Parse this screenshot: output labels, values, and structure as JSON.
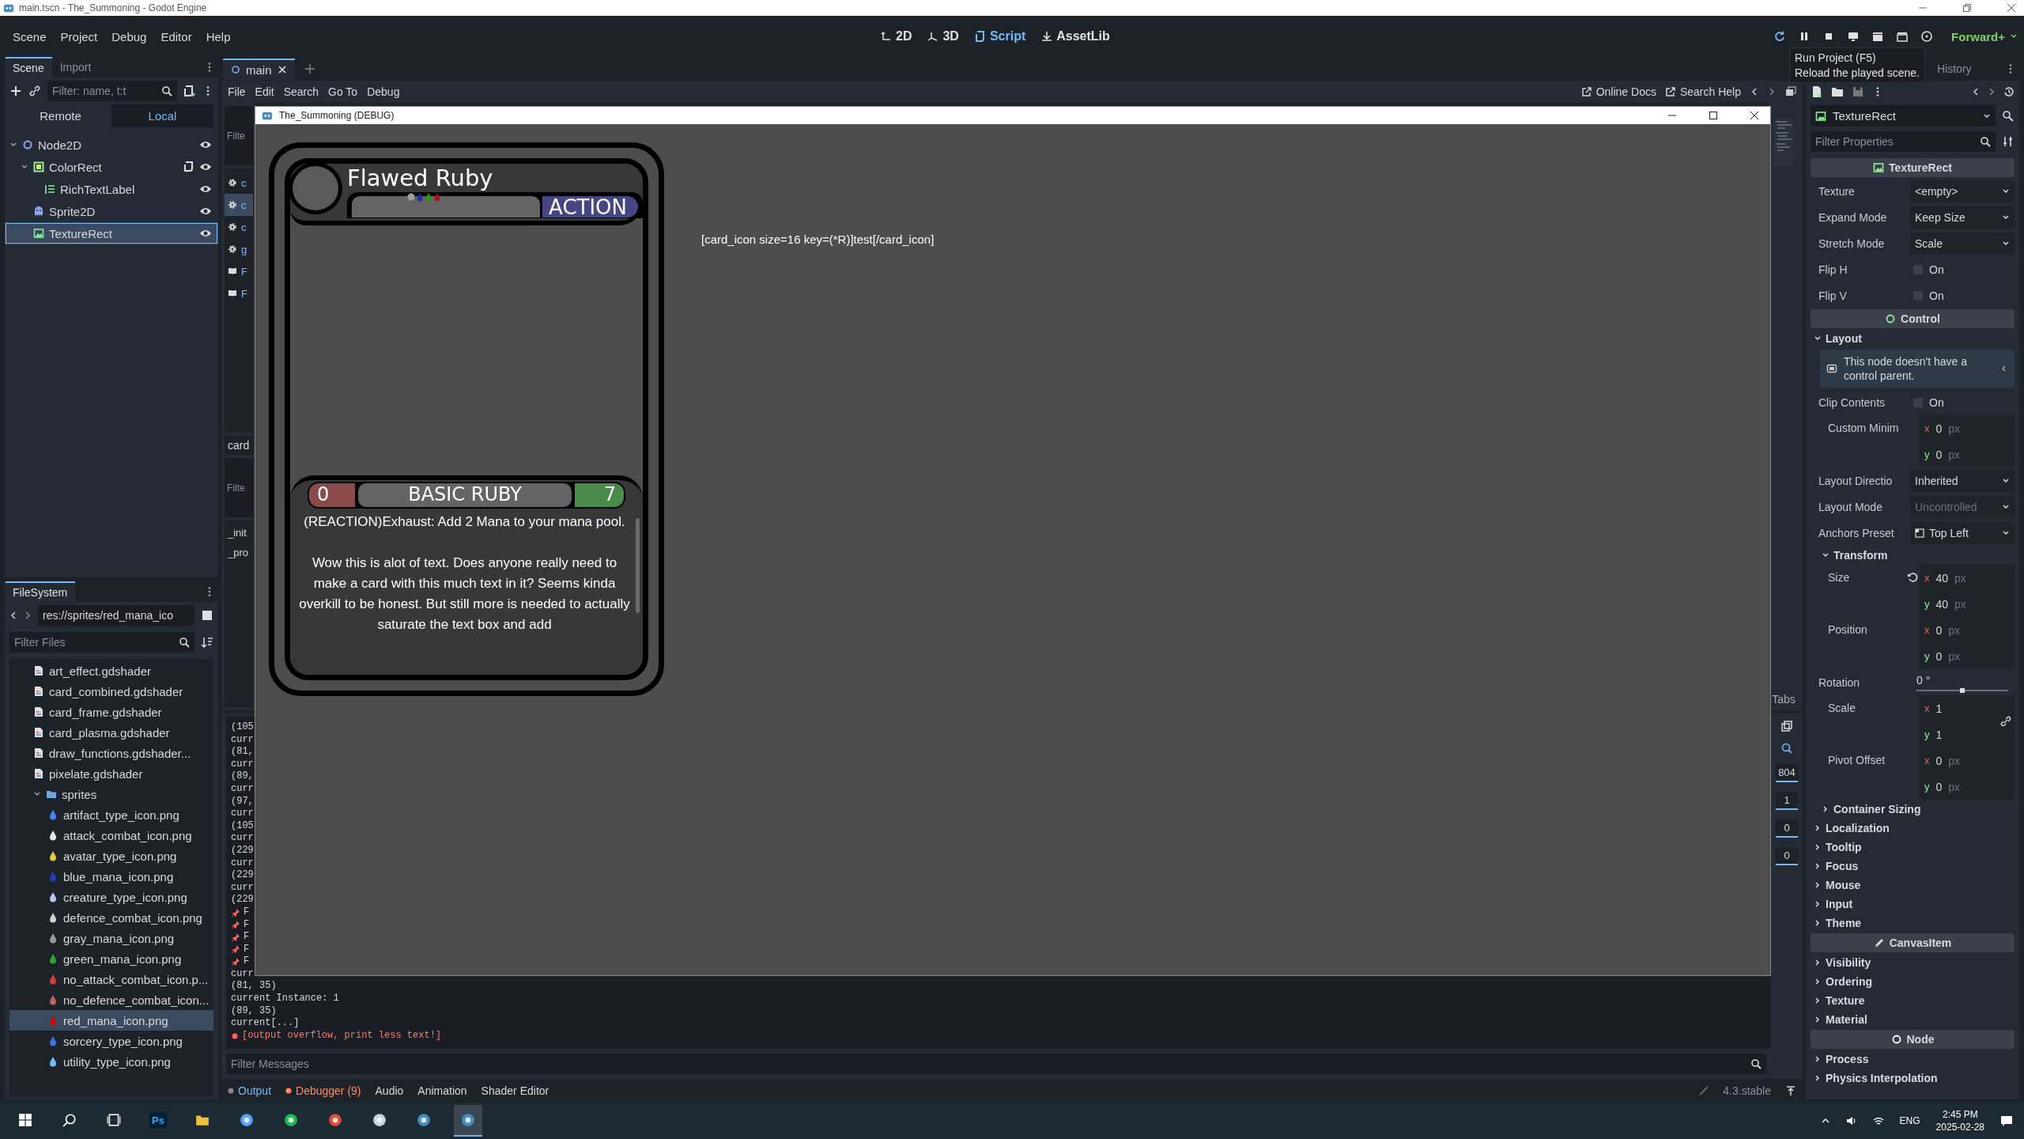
{
  "window": {
    "title": "main.tscn - The_Summoning - Godot Engine"
  },
  "main_menu": [
    "Scene",
    "Project",
    "Debug",
    "Editor",
    "Help"
  ],
  "workspaces": [
    {
      "label": "2D",
      "kind": "canvas",
      "selected": false
    },
    {
      "label": "3D",
      "kind": "spatial",
      "selected": false
    },
    {
      "label": "Script",
      "kind": "script",
      "selected": true
    },
    {
      "label": "AssetLib",
      "kind": "assetlib",
      "selected": false
    }
  ],
  "renderer": "Forward+",
  "tooltip": [
    "Run Project (F5)",
    "Reload the played scene."
  ],
  "scene_dock": {
    "tabs": [
      {
        "label": "Scene",
        "selected": true
      },
      {
        "label": "Import",
        "selected": false
      }
    ],
    "filter_placeholder": "Filter: name, t:t",
    "modes": [
      {
        "label": "Remote",
        "selected": false
      },
      {
        "label": "Local",
        "selected": true
      }
    ],
    "tree": [
      {
        "label": "Node2D",
        "kind": "node2d",
        "selected": false,
        "children": [
          {
            "label": "ColorRect",
            "kind": "colorrect",
            "script": true,
            "selected": false,
            "children": [
              {
                "label": "RichTextLabel",
                "kind": "richtext",
                "selected": false
              }
            ]
          },
          {
            "label": "Sprite2D",
            "kind": "sprite",
            "selected": false
          },
          {
            "label": "TextureRect",
            "kind": "texturerect",
            "selected": true
          }
        ]
      }
    ]
  },
  "filesystem": {
    "title": "FileSystem",
    "path": "res://sprites/red_mana_ico",
    "filter_placeholder": "Filter Files",
    "items": [
      {
        "label": "art_effect.gdshader",
        "kind": "shader",
        "selected": false
      },
      {
        "label": "card_combined.gdshader",
        "kind": "shader",
        "selected": false
      },
      {
        "label": "card_frame.gdshader",
        "kind": "shader",
        "selected": false
      },
      {
        "label": "card_plasma.gdshader",
        "kind": "shader",
        "selected": false
      },
      {
        "label": "draw_functions.gdshader...",
        "kind": "shader",
        "selected": false
      },
      {
        "label": "pixelate.gdshader",
        "kind": "shader",
        "selected": false
      },
      {
        "label": "sprites",
        "kind": "folder",
        "selected": false,
        "children": [
          {
            "label": "artifact_type_icon.png",
            "kind": "png",
            "color": "#4a7dff",
            "selected": false
          },
          {
            "label": "attack_combat_icon.png",
            "kind": "png",
            "color": "#e8e8e8",
            "selected": false
          },
          {
            "label": "avatar_type_icon.png",
            "kind": "png",
            "color": "#e8c840",
            "selected": false
          },
          {
            "label": "blue_mana_icon.png",
            "kind": "png",
            "color": "#2040c0",
            "selected": false
          },
          {
            "label": "creature_type_icon.png",
            "kind": "png",
            "color": "#b8c4e8",
            "selected": false
          },
          {
            "label": "defence_combat_icon.png",
            "kind": "png",
            "color": "#d0d0d0",
            "selected": false
          },
          {
            "label": "gray_mana_icon.png",
            "kind": "png",
            "color": "#9a9a9a",
            "selected": false
          },
          {
            "label": "green_mana_icon.png",
            "kind": "png",
            "color": "#30a030",
            "selected": false
          },
          {
            "label": "no_attack_combat_icon.p...",
            "kind": "png",
            "color": "#d04040",
            "selected": false
          },
          {
            "label": "no_defence_combat_icon...",
            "kind": "png",
            "color": "#c06060",
            "selected": false
          },
          {
            "label": "red_mana_icon.png",
            "kind": "png",
            "color": "#c01010",
            "selected": true
          },
          {
            "label": "sorcery_type_icon.png",
            "kind": "png",
            "color": "#4070e0",
            "selected": false
          },
          {
            "label": "utility_type_icon.png",
            "kind": "png",
            "color": "#70c0f0",
            "selected": false
          }
        ]
      }
    ]
  },
  "script_editor": {
    "tabs": [
      {
        "label": "main",
        "selected": true
      }
    ],
    "menu": [
      "File",
      "Edit",
      "Search",
      "Go To",
      "Debug"
    ],
    "links": [
      "Online Docs",
      "Search Help"
    ],
    "list_filter_placeholder": "Filte",
    "scripts": [
      {
        "label": "c",
        "kind": "script",
        "selected": false
      },
      {
        "label": "c",
        "kind": "script",
        "selected": true
      },
      {
        "label": "c",
        "kind": "script",
        "selected": false
      },
      {
        "label": "g",
        "kind": "script",
        "selected": false
      },
      {
        "label": "F",
        "kind": "doc",
        "selected": false
      },
      {
        "label": "F",
        "kind": "doc",
        "selected": false
      }
    ],
    "current": "card",
    "methods_filter_placeholder": "Filte",
    "methods": [
      "_init",
      "_pro"
    ],
    "status": "Tabs"
  },
  "game_window": {
    "title": "The_Summoning (DEBUG)",
    "card": {
      "name": "Flawed Ruby",
      "type": "ACTION",
      "cost": "0",
      "subtitle": "BASIC RUBY",
      "value": "7",
      "mana": [
        {
          "kind": "hex",
          "color": "#a0a0a0"
        },
        {
          "kind": "drop",
          "color": "#1530a8"
        },
        {
          "kind": "drop",
          "color": "#2a9a1a"
        },
        {
          "kind": "drop",
          "color": "#b01010"
        }
      ],
      "text": [
        "(REACTION)Exhaust: Add 2 Mana to your mana pool.",
        "Wow this is alot of text. Does anyone really need to make a card with this much text in it? Seems kinda overkill to be honest. But still more is needed to actually saturate the text box and add"
      ]
    },
    "debug_label": "[card_icon size=16 key=(*R)]test[/card_icon]"
  },
  "output": {
    "lines": [
      {
        "kind": "plain",
        "text": "(105"
      },
      {
        "kind": "plain",
        "text": "curr"
      },
      {
        "kind": "plain",
        "text": "(81,"
      },
      {
        "kind": "plain",
        "text": "curr"
      },
      {
        "kind": "plain",
        "text": "(89,"
      },
      {
        "kind": "plain",
        "text": "curr"
      },
      {
        "kind": "plain",
        "text": "(97,"
      },
      {
        "kind": "plain",
        "text": "curr"
      },
      {
        "kind": "plain",
        "text": "(105"
      },
      {
        "kind": "plain",
        "text": "curr"
      },
      {
        "kind": "plain",
        "text": "(229"
      },
      {
        "kind": "plain",
        "text": "curr"
      },
      {
        "kind": "plain",
        "text": "(229"
      },
      {
        "kind": "plain",
        "text": "curr"
      },
      {
        "kind": "plain",
        "text": "(229"
      },
      {
        "kind": "pin",
        "text": "F"
      },
      {
        "kind": "pin",
        "text": "F"
      },
      {
        "kind": "pin",
        "text": "F"
      },
      {
        "kind": "pin",
        "text": "F"
      },
      {
        "kind": "pin",
        "text": "F"
      },
      {
        "kind": "plain",
        "text": "curr"
      },
      {
        "kind": "plain",
        "text": "(81, 35)"
      },
      {
        "kind": "plain",
        "text": "current Instance: 1"
      },
      {
        "kind": "plain",
        "text": "(89, 35)"
      },
      {
        "kind": "plain",
        "text": "current[...]"
      },
      {
        "kind": "error",
        "text": "[output overflow, print less text!]"
      }
    ],
    "filter_placeholder": "Filter Messages",
    "counters": [
      "804",
      "1",
      "0",
      "0"
    ],
    "tabs": [
      {
        "label": "Output",
        "selected": true,
        "color": "#8c7f8f"
      },
      {
        "label": "Debugger (9)",
        "selected": false,
        "color": "#ff8a5c"
      },
      {
        "label": "Audio",
        "selected": false
      },
      {
        "label": "Animation",
        "selected": false
      },
      {
        "label": "Shader Editor",
        "selected": false
      }
    ],
    "version": "4.3.stable"
  },
  "inspector": {
    "history": "History",
    "object": "TextureRect",
    "filter_placeholder": "Filter Properties",
    "rows": [
      {
        "kind": "class",
        "label": "TextureRect",
        "color": "#8eef97"
      },
      {
        "kind": "dropdown",
        "label": "Texture",
        "value": "<empty>"
      },
      {
        "kind": "dropdown",
        "label": "Expand Mode",
        "value": "Keep Size"
      },
      {
        "kind": "dropdown",
        "label": "Stretch Mode",
        "value": "Scale"
      },
      {
        "kind": "check",
        "label": "Flip H",
        "value": "On",
        "checked": false
      },
      {
        "kind": "check",
        "label": "Flip V",
        "value": "On",
        "checked": false
      },
      {
        "kind": "class",
        "label": "Control",
        "color": "#8eef97"
      },
      {
        "kind": "section",
        "label": "Layout",
        "expanded": true
      },
      {
        "kind": "note",
        "label": "This node doesn't have a control parent."
      },
      {
        "kind": "check",
        "label": "Clip Contents",
        "value": "On",
        "checked": false
      },
      {
        "kind": "xy",
        "label": "Custom Minim",
        "fields": [
          {
            "axis": "x",
            "value": "0",
            "unit": "px"
          },
          {
            "axis": "y",
            "value": "0",
            "unit": "px"
          }
        ]
      },
      {
        "kind": "dropdown",
        "label": "Layout Directio",
        "value": "Inherited"
      },
      {
        "kind": "dropdown",
        "label": "Layout Mode",
        "value": "Uncontrolled",
        "disabled": true
      },
      {
        "kind": "dropdown",
        "label": "Anchors Preset",
        "value": "Top Left",
        "swatch": true
      },
      {
        "kind": "subsection",
        "label": "Transform",
        "expanded": true
      },
      {
        "kind": "xy",
        "label": "Size",
        "reset": true,
        "fields": [
          {
            "axis": "x",
            "value": "40",
            "unit": "px"
          },
          {
            "axis": "y",
            "value": "40",
            "unit": "px"
          }
        ]
      },
      {
        "kind": "xy",
        "label": "Position",
        "fields": [
          {
            "axis": "x",
            "value": "0",
            "unit": "px"
          },
          {
            "axis": "y",
            "value": "0",
            "unit": "px"
          }
        ]
      },
      {
        "kind": "slider",
        "label": "Rotation",
        "value": "0 °",
        "level": 0.5
      },
      {
        "kind": "xy",
        "label": "Scale",
        "linked": true,
        "fields": [
          {
            "axis": "x",
            "value": "1"
          },
          {
            "axis": "y",
            "value": "1"
          }
        ]
      },
      {
        "kind": "xy",
        "label": "Pivot Offset",
        "fields": [
          {
            "axis": "x",
            "value": "0",
            "unit": "px"
          },
          {
            "axis": "y",
            "value": "0",
            "unit": "px"
          }
        ]
      },
      {
        "kind": "subsection",
        "label": "Container Sizing",
        "expanded": false
      },
      {
        "kind": "section",
        "label": "Localization",
        "expanded": false
      },
      {
        "kind": "section",
        "label": "Tooltip",
        "expanded": false
      },
      {
        "kind": "section",
        "label": "Focus",
        "expanded": false
      },
      {
        "kind": "section",
        "label": "Mouse",
        "expanded": false
      },
      {
        "kind": "section",
        "label": "Input",
        "expanded": false
      },
      {
        "kind": "section",
        "label": "Theme",
        "expanded": false
      },
      {
        "kind": "class",
        "label": "CanvasItem",
        "color": "#dcdcdc"
      },
      {
        "kind": "section",
        "label": "Visibility",
        "expanded": false
      },
      {
        "kind": "section",
        "label": "Ordering",
        "expanded": false
      },
      {
        "kind": "section",
        "label": "Texture",
        "expanded": false
      },
      {
        "kind": "section",
        "label": "Material",
        "expanded": false
      },
      {
        "kind": "class",
        "label": "Node",
        "color": "#ffffff"
      },
      {
        "kind": "section",
        "label": "Process",
        "expanded": false
      },
      {
        "kind": "section",
        "label": "Physics Interpolation",
        "expanded": false
      }
    ]
  },
  "taskbar": {
    "apps": [
      {
        "kind": "start",
        "selected": false
      },
      {
        "kind": "search",
        "selected": false
      },
      {
        "kind": "taskview",
        "selected": false
      },
      {
        "kind": "ps",
        "label": "Ps",
        "selected": false
      },
      {
        "kind": "folder",
        "selected": false
      },
      {
        "kind": "radar",
        "selected": false
      },
      {
        "kind": "spotify",
        "selected": false
      },
      {
        "kind": "chrome",
        "selected": false
      },
      {
        "kind": "steam",
        "selected": false
      },
      {
        "kind": "godot",
        "selected": false
      },
      {
        "kind": "godot",
        "selected": true
      }
    ],
    "lang": "ENG",
    "time": "2:45 PM",
    "date": "2025-02-28"
  }
}
